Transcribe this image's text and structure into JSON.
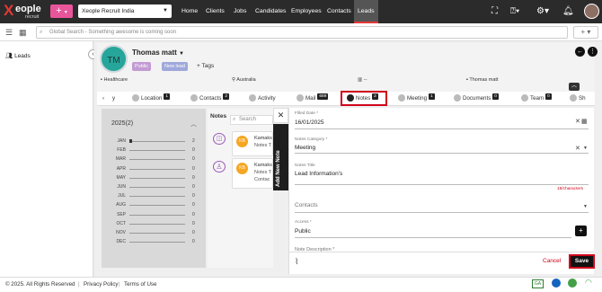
{
  "topbar": {
    "logo_text": "eople",
    "logo_sub": "recruit",
    "company": "Xeople Recruit India",
    "nav": [
      "Home",
      "Clients",
      "Jobs",
      "Candidates",
      "Employees",
      "Contacts",
      "Leads"
    ]
  },
  "subbar": {
    "search_placeholder": "Global Search - Something awesome is coming soon"
  },
  "sidebar": {
    "leads_label": "Leads"
  },
  "profile": {
    "initials": "TM",
    "name": "Thomas matt",
    "chip_public": "Public",
    "chip_new_lead": "New lead",
    "tags_label": "+ Tags",
    "industry": "Healthcare",
    "location": "Australia",
    "department": "--",
    "owner": "Thomas matt"
  },
  "tabs": [
    {
      "label": "y",
      "badge": ""
    },
    {
      "label": "Location",
      "badge": "1"
    },
    {
      "label": "Contacts",
      "badge": "2"
    },
    {
      "label": "Activity",
      "badge": ""
    },
    {
      "label": "Mail",
      "badge": "689"
    },
    {
      "label": "Notes",
      "badge": "2"
    },
    {
      "label": "Meeting",
      "badge": "1"
    },
    {
      "label": "Documents",
      "badge": "0"
    },
    {
      "label": "Team",
      "badge": "0"
    },
    {
      "label": "Sh",
      "badge": ""
    }
  ],
  "year_panel": {
    "title": "2025(2)",
    "months": [
      {
        "m": "JAN",
        "v": "2"
      },
      {
        "m": "FEB",
        "v": "0"
      },
      {
        "m": "MAR",
        "v": "0"
      },
      {
        "m": "APR",
        "v": "0"
      },
      {
        "m": "MAY",
        "v": "0"
      },
      {
        "m": "JUN",
        "v": "0"
      },
      {
        "m": "JUL",
        "v": "0"
      },
      {
        "m": "AUG",
        "v": "0"
      },
      {
        "m": "SEP",
        "v": "0"
      },
      {
        "m": "OCT",
        "v": "0"
      },
      {
        "m": "NOV",
        "v": "0"
      },
      {
        "m": "DEC",
        "v": "0"
      }
    ]
  },
  "notes_list": {
    "title": "Notes",
    "search_placeholder": "Search",
    "items": [
      {
        "initials": "KB",
        "line1": "Kamaks",
        "line2": "Notes T"
      },
      {
        "initials": "KB",
        "line1": "Kamaks",
        "line2": "Notes T",
        "line3": "Contac"
      }
    ]
  },
  "drawer": {
    "strip_label": "Add New Note",
    "filled_date_label": "Filled Date *",
    "filled_date": "16/01/2025",
    "category_label": "Notes Category *",
    "category": "Meeting",
    "title_label": "Notes Title",
    "title_value": "Lead Information's",
    "char_count": "18/characters",
    "contacts_label": "Contacts",
    "access_label": "Access *",
    "access_value": "Public",
    "description_label": "Note Description *",
    "cancel_label": "Cancel",
    "save_label": "Save"
  },
  "footer": {
    "copyright": "© 2025. All Rights Reserved",
    "privacy": "Privacy Policy",
    "terms": "Terms of Use",
    "ga": "GA"
  },
  "colors": {
    "brand_red": "#e53935",
    "pink": "#e8559a",
    "teal": "#26a69a",
    "highlight": "#d0021b"
  }
}
